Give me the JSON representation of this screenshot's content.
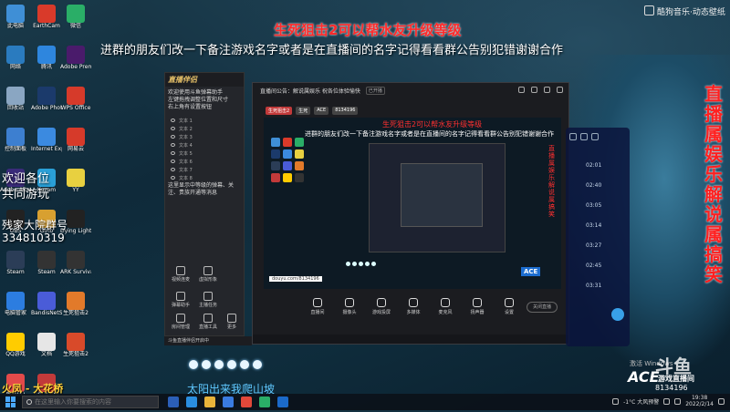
{
  "overlay": {
    "title": "生死狙击2可以帮水友升级等级",
    "notice": "进群的朋友们改一下备注游戏名字或者是在直播间的名字记得看看群公告别犯错谢谢合作",
    "vertical": "直播属娱乐解说属搞笑",
    "welcome": [
      "欢迎各位",
      "共同游玩"
    ],
    "group": [
      "残家大院群号",
      "334810319"
    ],
    "banner": "火凤 - 大花桥",
    "caption": "太阳出来我爬山坡",
    "watermark": "酷狗音乐·动态壁纸"
  },
  "desktop_icons": [
    {
      "label": "此电脑",
      "color": "#3f8fd6"
    },
    {
      "label": "网络",
      "color": "#2a7bbf"
    },
    {
      "label": "回收站",
      "color": "#8aa6c2"
    },
    {
      "label": "控制面板",
      "color": "#3d7fd0"
    },
    {
      "label": "Adobe After Effects",
      "color": "#3a2b7a"
    },
    {
      "label": "OBS",
      "color": "#222"
    },
    {
      "label": "Steam",
      "color": "#2b3d57"
    },
    {
      "label": "电脑管家",
      "color": "#2c7de0"
    },
    {
      "label": "QQ游戏",
      "color": "#ffcc00"
    },
    {
      "label": "网易UU",
      "color": "#e24a4a"
    }
  ],
  "desktop_icons_col2": [
    {
      "label": "EarthCam",
      "color": "#d93a2a"
    },
    {
      "label": "腾讯",
      "color": "#2e86de"
    },
    {
      "label": "Adobe Photoshop",
      "color": "#1b3a6b"
    },
    {
      "label": "Internet Explorer",
      "color": "#3b8ae0"
    },
    {
      "label": "Kazam",
      "color": "#2aa0d8"
    },
    {
      "label": "GoTo",
      "color": "#d8a030"
    },
    {
      "label": "Steam",
      "color": "#333"
    },
    {
      "label": "BandisNetShare",
      "color": "#4a5cd8"
    },
    {
      "label": "文档",
      "color": "#e6e6e6"
    },
    {
      "label": "SSI-4399",
      "color": "#c23a3a"
    }
  ],
  "desktop_icons_col3": [
    {
      "label": "微信",
      "color": "#2aae67"
    },
    {
      "label": "Adobe Premiere",
      "color": "#4a1b6b"
    },
    {
      "label": "WPS Office",
      "color": "#d63a2a"
    },
    {
      "label": "网易云",
      "color": "#d63a2a"
    },
    {
      "label": "YY",
      "color": "#e8d040"
    },
    {
      "label": "Dying Light",
      "color": "#222"
    },
    {
      "label": "ARK Survival",
      "color": "#333"
    },
    {
      "label": "生死狙击2",
      "color": "#e27a2a"
    },
    {
      "label": "生死狙击2",
      "color": "#d84a2a"
    }
  ],
  "assistant": {
    "brand": "直播伴侣",
    "messages": [
      "欢迎使用斗鱼弹幕助手",
      "左键拖拽调整位置和尺寸",
      "右上角有设置按钮"
    ],
    "rows": [
      "文本 1",
      "文本 2",
      "文本 3",
      "文本 4",
      "文本 5",
      "文本 6",
      "文本 7",
      "文本 8"
    ],
    "tip": "这里显示中等级的弹幕、关注、贵族开通等消息",
    "tools": [
      "视频连麦",
      "虚拟形象",
      "弹幕助手",
      "主播任务",
      "房间管理",
      "直播工具",
      "更多"
    ],
    "bottom_bar": "斗鱼直播伴侣开启中"
  },
  "stream": {
    "title": "直播间公告：解说属娱乐 祝各位体验愉快",
    "badge": "已开播",
    "tags": [
      "生死狙击2",
      "生死",
      "ACE",
      "8134196"
    ],
    "controls": [
      "直播间",
      "摄像头",
      "游戏投屏",
      "多媒体",
      "麦克风",
      "扬声器",
      "设置"
    ],
    "live_button": "关闭直播",
    "preview_url": "douyu.com/8134196"
  },
  "music": {
    "times": [
      "02:01",
      "02:40",
      "03:05",
      "03:14",
      "03:27",
      "02:45",
      "03:31"
    ]
  },
  "ace": {
    "logo": "ACE",
    "sub": "游戏直播间",
    "room": "8134196",
    "douyu": "斗鱼"
  },
  "windows_activate": "激活 Windows",
  "taskbar": {
    "search_placeholder": "在这里输入你要搜索的内容",
    "weather": "-1°C 大风预警",
    "time": "19:38",
    "date": "2022/2/14"
  },
  "colors": {
    "accent_red": "#ff2a2a",
    "caption_blue": "#5fc8ff",
    "banner_yellow": "#ffd23a",
    "ace_blue": "#1c6dd0"
  }
}
